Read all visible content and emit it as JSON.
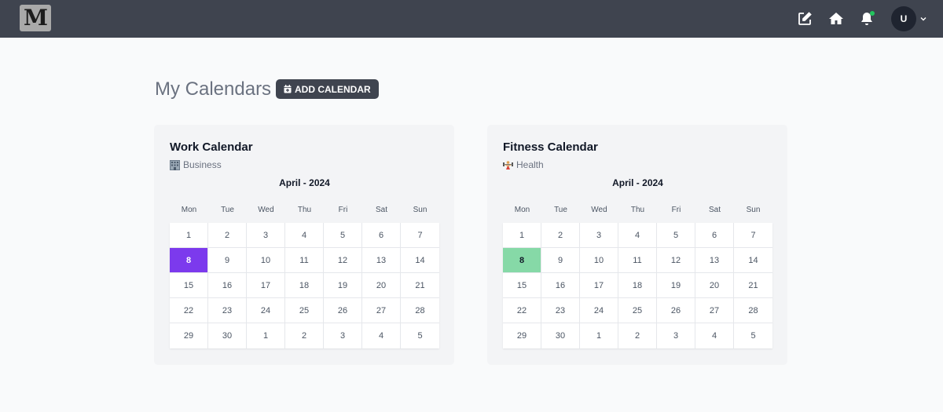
{
  "navbar": {
    "logo_text": "M",
    "icons": [
      "edit-icon",
      "home-icon",
      "bell-icon"
    ],
    "notification_dot_color": "#22c55e",
    "avatar_initial": "U"
  },
  "header": {
    "title": "My Calendars",
    "add_button_label": "ADD CALENDAR"
  },
  "weekdays": [
    "Mon",
    "Tue",
    "Wed",
    "Thu",
    "Fri",
    "Sat",
    "Sun"
  ],
  "calendars": [
    {
      "title": "Work Calendar",
      "category": "Business",
      "category_icon": "office-building-icon",
      "month_label": "April - 2024",
      "highlight_day": "8",
      "highlight_color": "#7c3aed",
      "days": [
        "1",
        "2",
        "3",
        "4",
        "5",
        "6",
        "7",
        "8",
        "9",
        "10",
        "11",
        "12",
        "13",
        "14",
        "15",
        "16",
        "17",
        "18",
        "19",
        "20",
        "21",
        "22",
        "23",
        "24",
        "25",
        "26",
        "27",
        "28",
        "29",
        "30",
        "1",
        "2",
        "3",
        "4",
        "5"
      ]
    },
    {
      "title": "Fitness Calendar",
      "category": "Health",
      "category_icon": "weightlifter-icon",
      "month_label": "April - 2024",
      "highlight_day": "8",
      "highlight_color": "#86d9a7",
      "days": [
        "1",
        "2",
        "3",
        "4",
        "5",
        "6",
        "7",
        "8",
        "9",
        "10",
        "11",
        "12",
        "13",
        "14",
        "15",
        "16",
        "17",
        "18",
        "19",
        "20",
        "21",
        "22",
        "23",
        "24",
        "25",
        "26",
        "27",
        "28",
        "29",
        "30",
        "1",
        "2",
        "3",
        "4",
        "5"
      ]
    }
  ]
}
